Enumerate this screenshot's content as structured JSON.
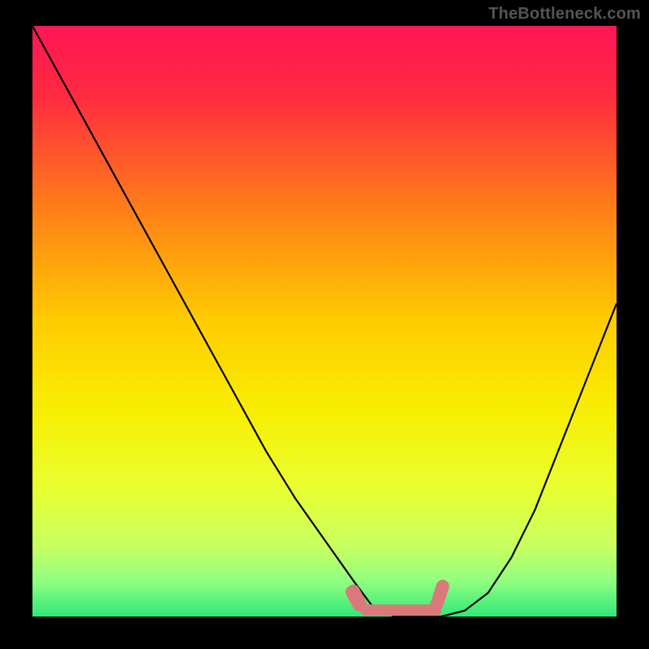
{
  "watermark": "TheBottleneck.com",
  "chart_data": {
    "type": "line",
    "title": "",
    "xlabel": "",
    "ylabel": "",
    "xlim": [
      0,
      100
    ],
    "ylim": [
      0,
      100
    ],
    "series": [
      {
        "name": "bottleneck-curve",
        "x": [
          0,
          5,
          10,
          15,
          20,
          25,
          30,
          35,
          40,
          45,
          50,
          55,
          58,
          62,
          66,
          70,
          74,
          78,
          82,
          86,
          90,
          94,
          98,
          100
        ],
        "y": [
          100,
          91,
          82,
          73,
          64,
          55,
          46,
          37,
          28,
          20,
          13,
          6,
          2,
          0,
          0,
          0,
          1,
          4,
          10,
          18,
          28,
          38,
          48,
          53
        ],
        "color": "#000000"
      }
    ],
    "gradient_stops": [
      {
        "offset": 0,
        "color": "#ff1555"
      },
      {
        "offset": 12,
        "color": "#ff2b40"
      },
      {
        "offset": 30,
        "color": "#ff7a1a"
      },
      {
        "offset": 50,
        "color": "#ffcc00"
      },
      {
        "offset": 65,
        "color": "#f8ee00"
      },
      {
        "offset": 78,
        "color": "#eaff30"
      },
      {
        "offset": 88,
        "color": "#c8ff60"
      },
      {
        "offset": 94,
        "color": "#90ff80"
      },
      {
        "offset": 100,
        "color": "#30e878"
      }
    ],
    "annotation": {
      "name": "optimal-range-marker",
      "x_range": [
        56,
        74
      ],
      "color": "#d97a7a"
    }
  }
}
